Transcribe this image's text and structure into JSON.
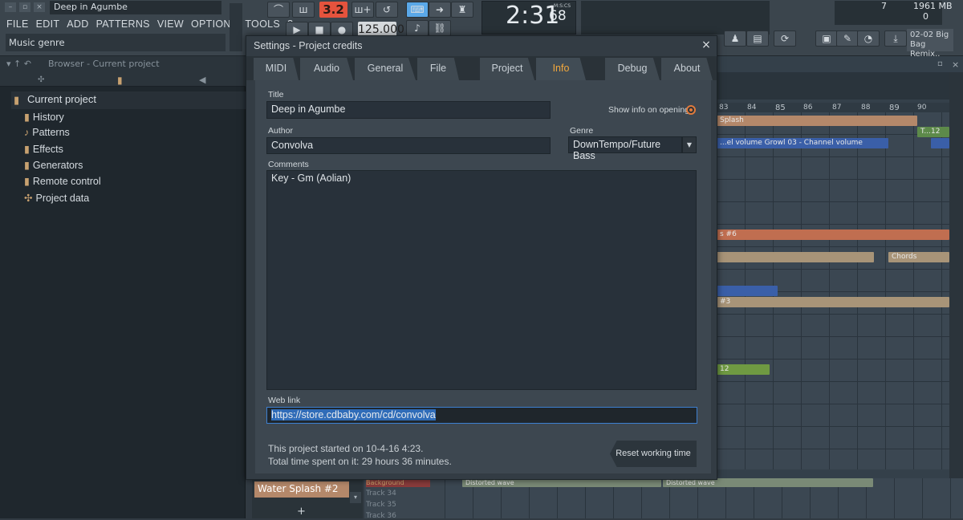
{
  "app": {
    "project_title": "Deep in Agumbe",
    "menu": [
      "FILE",
      "EDIT",
      "ADD",
      "PATTERNS",
      "VIEW",
      "OPTIONS",
      "TOOLS",
      "?"
    ],
    "hint": "Music genre",
    "pattern_number": "3.2",
    "tempo": "125.000",
    "time_main": "2:31",
    "time_frac": "68",
    "time_unit": "M:S:CS",
    "cpu_count": "7",
    "memory": "1961 MB",
    "poly": "0",
    "song_pos_top": "02-02  Big",
    "song_pos_bottom": "Bag Remix.."
  },
  "browser": {
    "title": "Browser - Current project",
    "root": "Current project",
    "items": [
      {
        "label": "History",
        "icon": "history-icon"
      },
      {
        "label": "Patterns",
        "icon": "note-icon"
      },
      {
        "label": "Effects",
        "icon": "effects-icon"
      },
      {
        "label": "Generators",
        "icon": "generator-icon"
      },
      {
        "label": "Remote control",
        "icon": "remote-control-icon"
      },
      {
        "label": "Project data",
        "icon": "project-data-icon"
      }
    ]
  },
  "playlist": {
    "ruler": [
      "83",
      "84",
      "85",
      "86",
      "87",
      "88",
      "89",
      "90"
    ],
    "clips": {
      "splash": "Splash",
      "t12": "T...12",
      "volume": "...el volume  Growl 03 - Channel volume",
      "s6": "s #6",
      "chords": "Chords",
      "hash3": "#3",
      "n12": "12",
      "distorted_a": "Distorted wave",
      "distorted_b": "Distorted wave"
    },
    "pattern_name": "Water Splash #2",
    "tracks": [
      "Background",
      "Track 34",
      "Track 35",
      "Track 36"
    ],
    "add": "+"
  },
  "dialog": {
    "title": "Settings - Project credits",
    "close": "×",
    "tabs": [
      "MIDI",
      "Audio",
      "General",
      "File",
      "Project",
      "Info",
      "Debug",
      "About"
    ],
    "active_tab": "Info",
    "title_label": "Title",
    "title_value": "Deep in Agumbe",
    "show_info_label": "Show info on opening",
    "author_label": "Author",
    "author_value": "Convolva",
    "genre_label": "Genre",
    "genre_value": "DownTempo/Future Bass",
    "comments_label": "Comments",
    "comments_value": "Key - Gm (Aolian)",
    "weblink_label": "Web link",
    "weblink_value": "https://store.cdbaby.com/cd/convolva",
    "started": "This project started on 10-4-16 4:23.",
    "time_spent": "Total time spent on it: 29 hours 36 minutes.",
    "reset_button": "Reset working time"
  },
  "colors": {
    "accent": "#f3a83c",
    "radio": "#e07a3c",
    "selection": "#2f6cb8",
    "pattern_red": "#e5533d"
  }
}
